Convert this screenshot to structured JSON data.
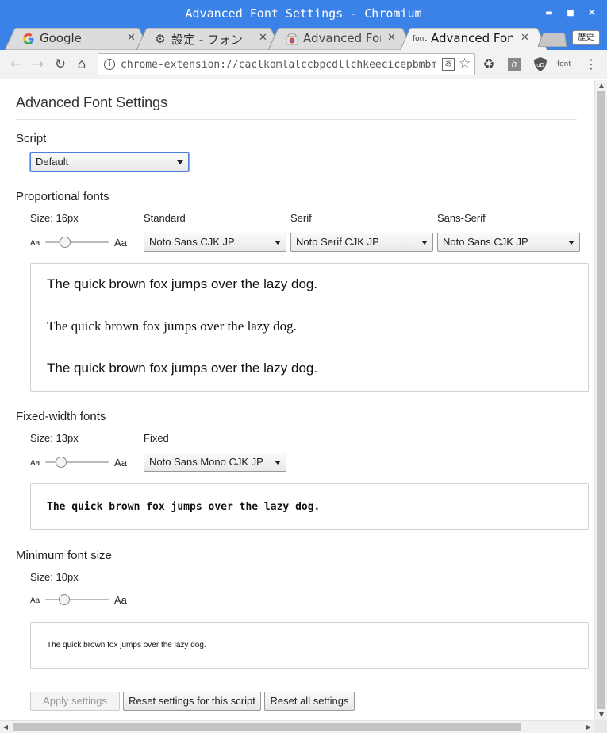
{
  "window": {
    "title": "Advanced Font Settings - Chromium",
    "minimize": "▬",
    "maximize": "■",
    "close": "✕"
  },
  "tabs": [
    {
      "label": "Google",
      "favicon": "google-icon"
    },
    {
      "label": "設定 - フォン",
      "favicon": "gear-icon"
    },
    {
      "label": "Advanced Font",
      "favicon": "chrome-webstore-icon"
    },
    {
      "label": "Advanced Font",
      "favicon": "font-extension-icon",
      "favicon_text": "font",
      "active": true
    }
  ],
  "profile_button": "歴史",
  "omnibox": {
    "url": "chrome-extension://caclkomlalccbpcdllchkeecicepbmbm/options.html",
    "translate": "あ"
  },
  "extensions": {
    "ublock_text": "uD",
    "font_ext_text": "font"
  },
  "page": {
    "title": "Advanced Font Settings",
    "script": {
      "heading": "Script",
      "selected": "Default"
    },
    "proportional": {
      "heading": "Proportional fonts",
      "size_label": "Size: 16px",
      "size_fraction": 0.28,
      "aa_small": "Aa",
      "aa_large": "Aa",
      "standard_label": "Standard",
      "standard_value": "Noto Sans CJK JP",
      "serif_label": "Serif",
      "serif_value": "Noto Serif CJK JP",
      "sans_label": "Sans-Serif",
      "sans_value": "Noto Sans CJK JP",
      "sample_standard": "The quick brown fox jumps over the lazy dog.",
      "sample_serif": "The quick brown fox jumps over the lazy dog.",
      "sample_sans": "The quick brown fox jumps over the lazy dog."
    },
    "fixed": {
      "heading": "Fixed-width fonts",
      "size_label": "Size: 13px",
      "size_fraction": 0.2,
      "aa_small": "Aa",
      "aa_large": "Aa",
      "fixed_label": "Fixed",
      "fixed_value": "Noto Sans Mono CJK JP",
      "sample": "The quick brown fox jumps over the lazy dog."
    },
    "minimum": {
      "heading": "Minimum font size",
      "size_label": "Size: 10px",
      "size_fraction": 0.25,
      "aa_small": "Aa",
      "aa_large": "Aa",
      "sample": "The quick brown fox jumps over the lazy dog."
    },
    "buttons": {
      "apply": "Apply settings",
      "reset_script": "Reset settings for this script",
      "reset_all": "Reset all settings"
    }
  },
  "colors": {
    "titlebar": "#3b82e8",
    "focus": "#4a7fd8"
  }
}
